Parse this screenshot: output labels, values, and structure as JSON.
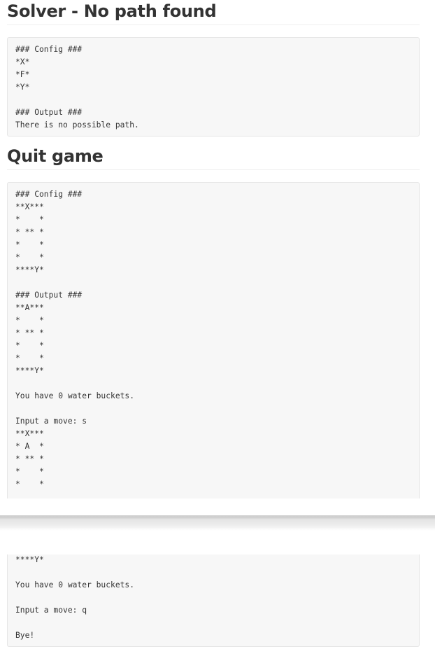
{
  "sections": [
    {
      "title": "Solver - No path found",
      "lines": [
        "### Config ###",
        "*X*",
        "*F*",
        "*Y*",
        "",
        "### Output ###",
        "There is no possible path."
      ]
    },
    {
      "title": "Quit game",
      "lines": [
        "### Config ###",
        "**X***",
        "*    *",
        "* ** *",
        "*    *",
        "*    *",
        "****Y*",
        "",
        "### Output ###",
        "**A***",
        "*    *",
        "* ** *",
        "*    *",
        "*    *",
        "****Y*",
        "",
        "You have 0 water buckets.",
        "",
        "Input a move: s",
        "**X***",
        "* A  *",
        "* ** *",
        "*    *",
        "*    *"
      ],
      "continued_lines": [
        "****Y*",
        "",
        "You have 0 water buckets.",
        "",
        "Input a move: q",
        "",
        "Bye!"
      ]
    }
  ]
}
